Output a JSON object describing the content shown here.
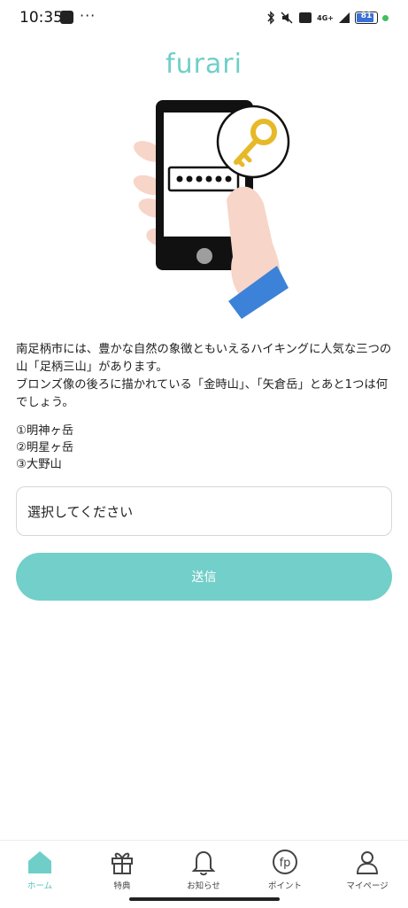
{
  "status_bar": {
    "time": "10:35",
    "dots": "···",
    "network": "4G+",
    "battery": "81",
    "battery_color": "#3a6fd6"
  },
  "app": {
    "logo": "furari",
    "brand_color": "#6fcfc8"
  },
  "question": {
    "line1": "南足柄市には、豊かな自然の象徴ともいえるハイキングに人気な三つの山「足柄三山」があります。",
    "line2": "ブロンズ像の後ろに描かれている「金時山」、「矢倉岳」とあと1つは何でしょう。"
  },
  "options": [
    "①明神ヶ岳",
    "②明星ヶ岳",
    "③大野山"
  ],
  "select": {
    "placeholder": "選択してください"
  },
  "submit": {
    "label": "送信",
    "color": "#72cfc9"
  },
  "bottom_nav": [
    {
      "label": "ホーム",
      "icon": "home-icon",
      "active": true
    },
    {
      "label": "特典",
      "icon": "gift-icon",
      "active": false
    },
    {
      "label": "お知らせ",
      "icon": "bell-icon",
      "active": false
    },
    {
      "label": "ポイント",
      "icon": "fp-points-icon",
      "active": false
    },
    {
      "label": "マイページ",
      "icon": "person-icon",
      "active": false
    }
  ]
}
